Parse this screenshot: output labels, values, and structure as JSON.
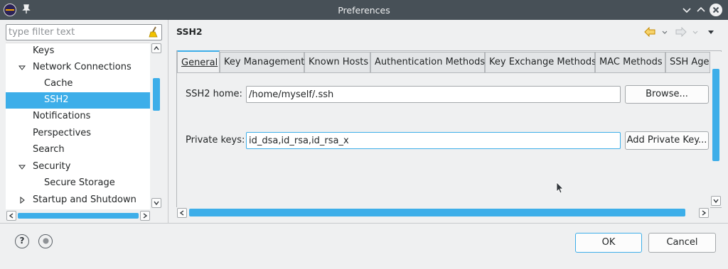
{
  "window": {
    "title": "Preferences"
  },
  "filter": {
    "placeholder": "type filter text"
  },
  "tree": {
    "items": [
      {
        "label": "Keys"
      },
      {
        "label": "Network Connections"
      },
      {
        "label": "Cache"
      },
      {
        "label": "SSH2"
      },
      {
        "label": "Notifications"
      },
      {
        "label": "Perspectives"
      },
      {
        "label": "Search"
      },
      {
        "label": "Security"
      },
      {
        "label": "Secure Storage"
      },
      {
        "label": "Startup and Shutdown"
      }
    ]
  },
  "page": {
    "title": "SSH2"
  },
  "tabs": [
    {
      "label": "General"
    },
    {
      "label": "Key Management"
    },
    {
      "label": "Known Hosts"
    },
    {
      "label": "Authentication Methods"
    },
    {
      "label": "Key Exchange Methods"
    },
    {
      "label": "MAC Methods"
    },
    {
      "label": "SSH Ager"
    }
  ],
  "general": {
    "ssh2_home_label": "SSH2 home:",
    "ssh2_home_value": "/home/myself/.ssh",
    "browse_label": "Browse...",
    "private_keys_label": "Private keys:",
    "private_keys_value": "id_dsa,id_rsa,id_rsa_x",
    "add_private_key_label": "Add Private Key..."
  },
  "buttons": {
    "ok": "OK",
    "cancel": "Cancel"
  },
  "icons": {
    "help": "question-mark-icon",
    "record": "record-icon"
  },
  "colors": {
    "accent": "#3daee9",
    "titlebar": "#475057"
  }
}
